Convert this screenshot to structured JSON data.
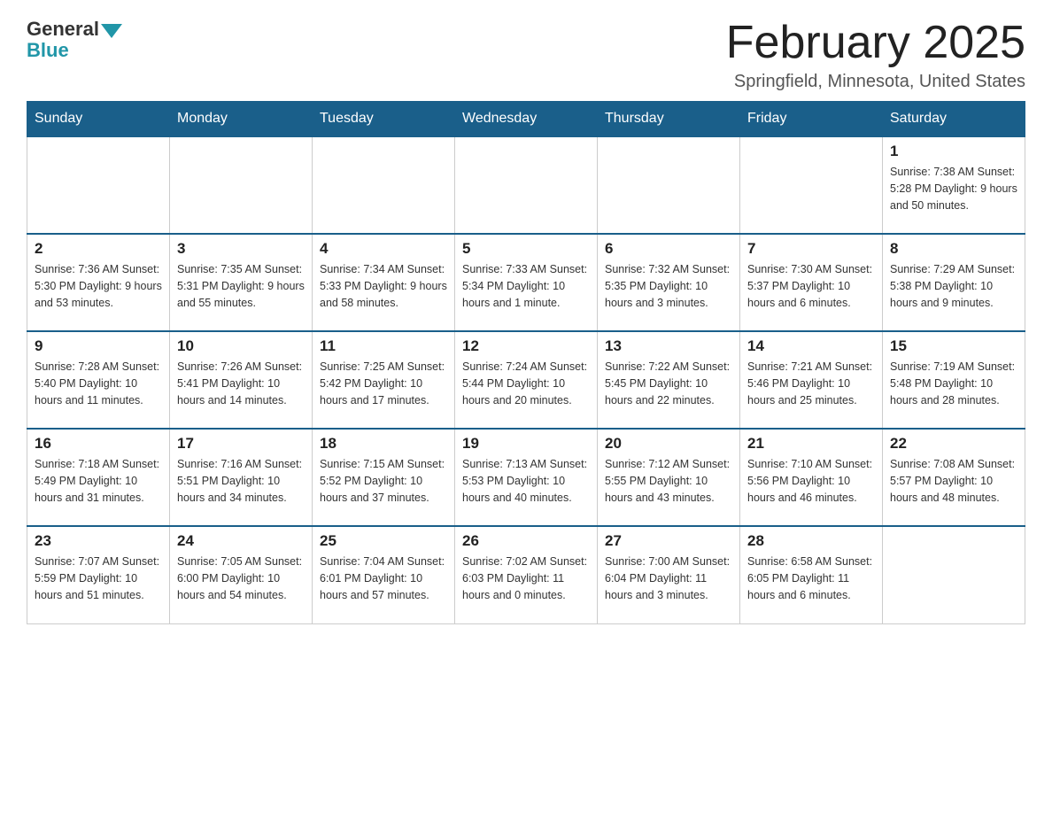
{
  "header": {
    "logo_general": "General",
    "logo_blue": "Blue",
    "title": "February 2025",
    "subtitle": "Springfield, Minnesota, United States"
  },
  "weekdays": [
    "Sunday",
    "Monday",
    "Tuesday",
    "Wednesday",
    "Thursday",
    "Friday",
    "Saturday"
  ],
  "weeks": [
    [
      {
        "day": "",
        "info": ""
      },
      {
        "day": "",
        "info": ""
      },
      {
        "day": "",
        "info": ""
      },
      {
        "day": "",
        "info": ""
      },
      {
        "day": "",
        "info": ""
      },
      {
        "day": "",
        "info": ""
      },
      {
        "day": "1",
        "info": "Sunrise: 7:38 AM\nSunset: 5:28 PM\nDaylight: 9 hours\nand 50 minutes."
      }
    ],
    [
      {
        "day": "2",
        "info": "Sunrise: 7:36 AM\nSunset: 5:30 PM\nDaylight: 9 hours\nand 53 minutes."
      },
      {
        "day": "3",
        "info": "Sunrise: 7:35 AM\nSunset: 5:31 PM\nDaylight: 9 hours\nand 55 minutes."
      },
      {
        "day": "4",
        "info": "Sunrise: 7:34 AM\nSunset: 5:33 PM\nDaylight: 9 hours\nand 58 minutes."
      },
      {
        "day": "5",
        "info": "Sunrise: 7:33 AM\nSunset: 5:34 PM\nDaylight: 10 hours\nand 1 minute."
      },
      {
        "day": "6",
        "info": "Sunrise: 7:32 AM\nSunset: 5:35 PM\nDaylight: 10 hours\nand 3 minutes."
      },
      {
        "day": "7",
        "info": "Sunrise: 7:30 AM\nSunset: 5:37 PM\nDaylight: 10 hours\nand 6 minutes."
      },
      {
        "day": "8",
        "info": "Sunrise: 7:29 AM\nSunset: 5:38 PM\nDaylight: 10 hours\nand 9 minutes."
      }
    ],
    [
      {
        "day": "9",
        "info": "Sunrise: 7:28 AM\nSunset: 5:40 PM\nDaylight: 10 hours\nand 11 minutes."
      },
      {
        "day": "10",
        "info": "Sunrise: 7:26 AM\nSunset: 5:41 PM\nDaylight: 10 hours\nand 14 minutes."
      },
      {
        "day": "11",
        "info": "Sunrise: 7:25 AM\nSunset: 5:42 PM\nDaylight: 10 hours\nand 17 minutes."
      },
      {
        "day": "12",
        "info": "Sunrise: 7:24 AM\nSunset: 5:44 PM\nDaylight: 10 hours\nand 20 minutes."
      },
      {
        "day": "13",
        "info": "Sunrise: 7:22 AM\nSunset: 5:45 PM\nDaylight: 10 hours\nand 22 minutes."
      },
      {
        "day": "14",
        "info": "Sunrise: 7:21 AM\nSunset: 5:46 PM\nDaylight: 10 hours\nand 25 minutes."
      },
      {
        "day": "15",
        "info": "Sunrise: 7:19 AM\nSunset: 5:48 PM\nDaylight: 10 hours\nand 28 minutes."
      }
    ],
    [
      {
        "day": "16",
        "info": "Sunrise: 7:18 AM\nSunset: 5:49 PM\nDaylight: 10 hours\nand 31 minutes."
      },
      {
        "day": "17",
        "info": "Sunrise: 7:16 AM\nSunset: 5:51 PM\nDaylight: 10 hours\nand 34 minutes."
      },
      {
        "day": "18",
        "info": "Sunrise: 7:15 AM\nSunset: 5:52 PM\nDaylight: 10 hours\nand 37 minutes."
      },
      {
        "day": "19",
        "info": "Sunrise: 7:13 AM\nSunset: 5:53 PM\nDaylight: 10 hours\nand 40 minutes."
      },
      {
        "day": "20",
        "info": "Sunrise: 7:12 AM\nSunset: 5:55 PM\nDaylight: 10 hours\nand 43 minutes."
      },
      {
        "day": "21",
        "info": "Sunrise: 7:10 AM\nSunset: 5:56 PM\nDaylight: 10 hours\nand 46 minutes."
      },
      {
        "day": "22",
        "info": "Sunrise: 7:08 AM\nSunset: 5:57 PM\nDaylight: 10 hours\nand 48 minutes."
      }
    ],
    [
      {
        "day": "23",
        "info": "Sunrise: 7:07 AM\nSunset: 5:59 PM\nDaylight: 10 hours\nand 51 minutes."
      },
      {
        "day": "24",
        "info": "Sunrise: 7:05 AM\nSunset: 6:00 PM\nDaylight: 10 hours\nand 54 minutes."
      },
      {
        "day": "25",
        "info": "Sunrise: 7:04 AM\nSunset: 6:01 PM\nDaylight: 10 hours\nand 57 minutes."
      },
      {
        "day": "26",
        "info": "Sunrise: 7:02 AM\nSunset: 6:03 PM\nDaylight: 11 hours\nand 0 minutes."
      },
      {
        "day": "27",
        "info": "Sunrise: 7:00 AM\nSunset: 6:04 PM\nDaylight: 11 hours\nand 3 minutes."
      },
      {
        "day": "28",
        "info": "Sunrise: 6:58 AM\nSunset: 6:05 PM\nDaylight: 11 hours\nand 6 minutes."
      },
      {
        "day": "",
        "info": ""
      }
    ]
  ]
}
